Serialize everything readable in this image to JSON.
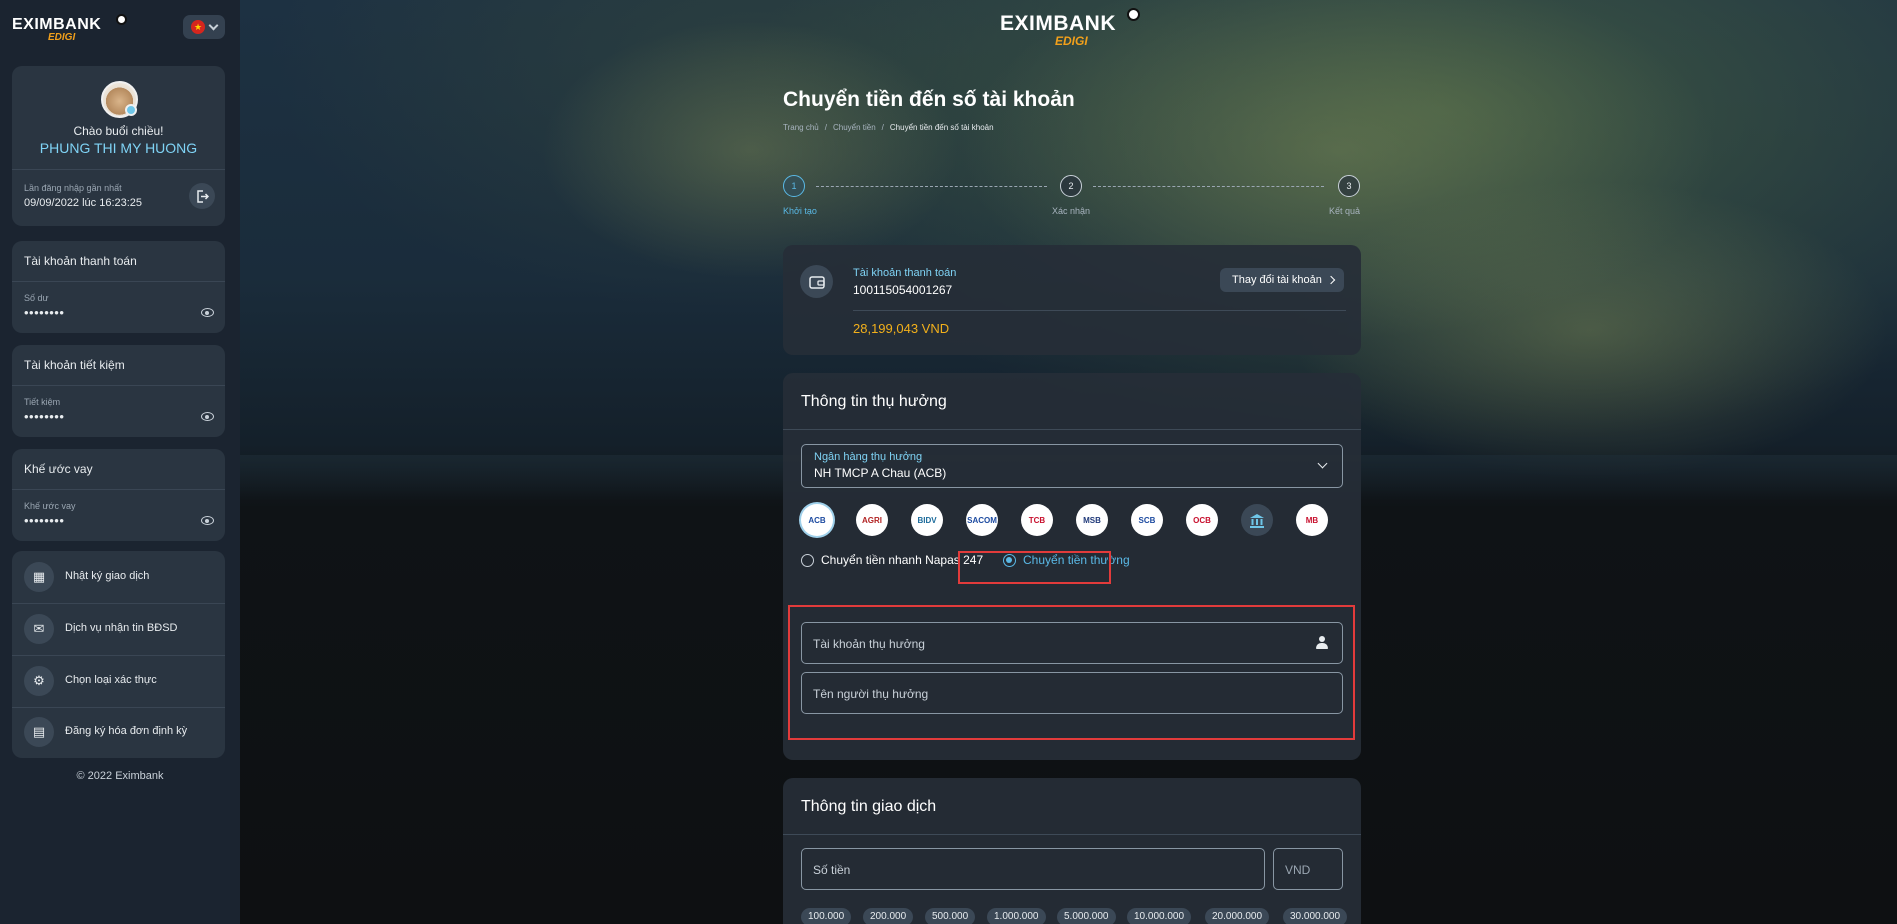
{
  "brand": {
    "name": "EXIMBANK",
    "sub": "EDIGI"
  },
  "sidebar": {
    "language_flag": "★",
    "user": {
      "greeting": "Chào buổi chiều!",
      "name": "PHUNG THI MY HUONG",
      "last_login_label": "Lần đăng nhập gần nhất",
      "last_login_value": "09/09/2022 lúc 16:23:25"
    },
    "accounts": [
      {
        "title": "Tài khoản thanh toán",
        "sub": "Số dư",
        "masked": "••••••••"
      },
      {
        "title": "Tài khoản tiết kiệm",
        "sub": "Tiết kiệm",
        "masked": "••••••••"
      },
      {
        "title": "Khế ước vay",
        "sub": "Khế ước vay",
        "masked": "••••••••"
      }
    ],
    "menu": [
      {
        "label": "Nhật ký giao dịch",
        "icon": "calendar-icon"
      },
      {
        "label": "Dịch vụ nhận tin BĐSD",
        "icon": "money-message-icon"
      },
      {
        "label": "Chọn loại xác thực",
        "icon": "shield-settings-icon"
      },
      {
        "label": "Đăng ký hóa đơn định kỳ",
        "icon": "bill-icon"
      }
    ],
    "copyright": "© 2022 Eximbank"
  },
  "main": {
    "title": "Chuyển tiền đến số tài khoản",
    "breadcrumb": [
      "Trang chủ",
      "Chuyển tiền",
      "Chuyển tiền đến số tài khoản"
    ],
    "steps": [
      {
        "num": "1",
        "label": "Khởi tạo"
      },
      {
        "num": "2",
        "label": "Xác nhận"
      },
      {
        "num": "3",
        "label": "Kết quả"
      }
    ],
    "source": {
      "title": "Tài khoản thanh toán",
      "number": "100115054001267",
      "change_label": "Thay đổi tài khoản",
      "balance": "28,199,043 VND"
    },
    "beneficiary": {
      "heading": "Thông tin thụ hưởng",
      "bank_label": "Ngân hàng thụ hưởng",
      "bank_value": "NH TMCP A Chau (ACB)",
      "bank_logos": [
        "ACB",
        "AGRI",
        "BIDV",
        "SACOM",
        "TCB",
        "MSB",
        "SCB",
        "OCB",
        "more",
        "MB"
      ],
      "radio_fast": "Chuyển tiền nhanh Napas 247",
      "radio_normal": "Chuyển tiền thường",
      "account_placeholder": "Tài khoản thụ hưởng",
      "name_placeholder": "Tên người thụ hưởng"
    },
    "transaction": {
      "heading": "Thông tin giao dịch",
      "amount_placeholder": "Số tiền",
      "currency": "VND",
      "chips": [
        "100.000",
        "200.000",
        "500.000",
        "1.000.000",
        "5.000.000",
        "10.000.000",
        "20.000.000",
        "30.000.000"
      ]
    }
  }
}
